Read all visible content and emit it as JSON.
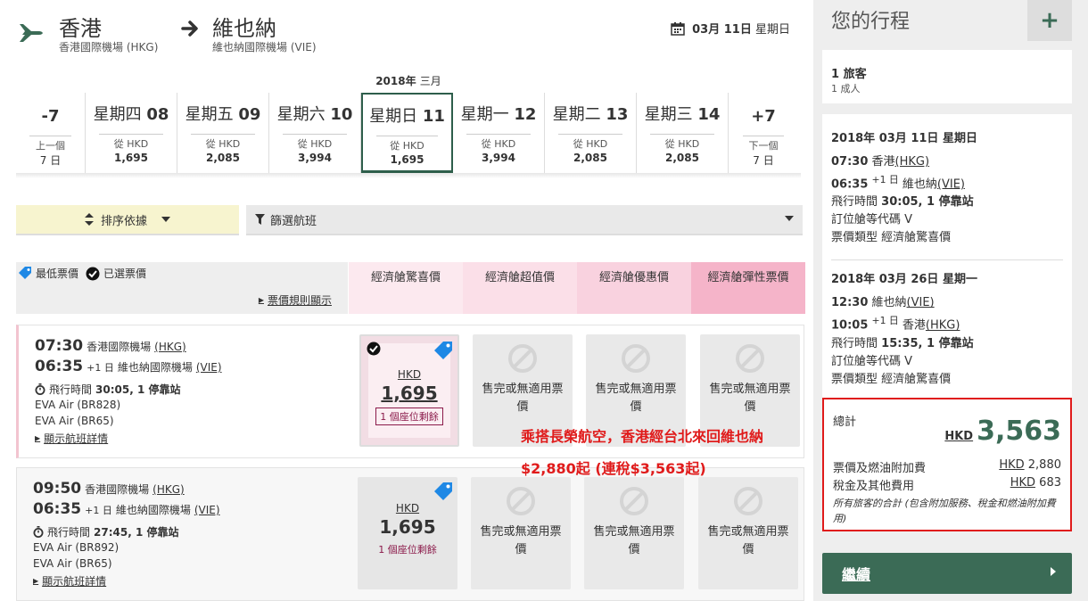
{
  "route": {
    "origin_city": "香港",
    "origin_airport": "香港國際機場 (HKG)",
    "dest_city": "維也納",
    "dest_airport": "維也納國際機場 (VIE)",
    "date_label": "03月 11日 星期日",
    "date_bold": "03月 11日",
    "date_day": "星期日"
  },
  "calendar": {
    "year": "2018年",
    "month": "三月",
    "prev": {
      "big": "-7",
      "label": "上一個",
      "days": "7 日"
    },
    "next": {
      "big": "+7",
      "label": "下一個",
      "days": "7 日"
    },
    "days": [
      {
        "weekday": "星期四",
        "day": "08",
        "from": "從 HKD",
        "price": "1,695"
      },
      {
        "weekday": "星期五",
        "day": "09",
        "from": "從 HKD",
        "price": "2,085"
      },
      {
        "weekday": "星期六",
        "day": "10",
        "from": "從 HKD",
        "price": "3,994"
      },
      {
        "weekday": "星期日",
        "day": "11",
        "from": "從 HKD",
        "price": "1,695"
      },
      {
        "weekday": "星期一",
        "day": "12",
        "from": "從 HKD",
        "price": "3,994"
      },
      {
        "weekday": "星期二",
        "day": "13",
        "from": "從 HKD",
        "price": "2,085"
      },
      {
        "weekday": "星期三",
        "day": "14",
        "from": "從 HKD",
        "price": "2,085"
      }
    ]
  },
  "filters": {
    "sort_label": "排序依據",
    "filter_label": "篩選航班"
  },
  "legend": {
    "lowest": "最低票價",
    "selected": "已選票價",
    "rules_link": "票價規則顯示"
  },
  "fare_columns": [
    "經濟艙驚喜價",
    "經濟艙超值價",
    "經濟艙優惠價",
    "經濟艙彈性票價"
  ],
  "flights": [
    {
      "depart_time": "07:30",
      "depart_airport": "香港國際機場",
      "depart_code": "(HKG)",
      "arrive_time": "06:35",
      "plus_day": "+1 日",
      "arrive_airport": "維也納國際機場",
      "arrive_code": "(VIE)",
      "duration_label": "飛行時間",
      "duration": "30:05, 1 停靠站",
      "legs": [
        "EVA Air (BR828)",
        "EVA Air (BR65)"
      ],
      "details_link": "顯示航班詳情",
      "fare_currency": "HKD",
      "fare_amount": "1,695",
      "seats": "1 個座位剩餘",
      "na_text": "售完或無適用票價"
    },
    {
      "depart_time": "09:50",
      "depart_airport": "香港國際機場",
      "depart_code": "(HKG)",
      "arrive_time": "06:35",
      "plus_day": "+1 日",
      "arrive_airport": "維也納國際機場",
      "arrive_code": "(VIE)",
      "duration_label": "飛行時間",
      "duration": "27:45, 1 停靠站",
      "legs": [
        "EVA Air (BR892)",
        "EVA Air (BR65)"
      ],
      "details_link": "顯示航班詳情",
      "fare_currency": "HKD",
      "fare_amount": "1,695",
      "seats": "1 個座位剩餘",
      "na_text": "售完或無適用票價"
    }
  ],
  "promo": {
    "line1": "乘搭長榮航空，香港經台北來回維也納",
    "line2": "$2,880起 (連稅$3,563起)"
  },
  "itinerary": {
    "title": "您的行程",
    "plus": "+",
    "pax_count": "1 旅客",
    "pax_detail": "1 成人",
    "outbound": {
      "date": "2018年 03月 11日 星期日",
      "dep": "07:30",
      "dep_city": "香港",
      "dep_code": "(HKG)",
      "arr": "06:35",
      "plus": "+1 日",
      "arr_city": "維也納",
      "arr_code": "(VIE)",
      "duration_label": "飛行時間",
      "duration": "30:05, 1 停靠站",
      "booking_class": "訂位艙等代碼 V",
      "fare_type": "票價類型 經濟艙驚喜價"
    },
    "inbound": {
      "date": "2018年 03月 26日 星期一",
      "dep": "12:30",
      "dep_city": "維也納",
      "dep_code": "(VIE)",
      "arr": "10:05",
      "plus": "+1 日",
      "arr_city": "香港",
      "arr_code": "(HKG)",
      "duration_label": "飛行時間",
      "duration": "15:35, 1 停靠站",
      "booking_class": "訂位艙等代碼 V",
      "fare_type": "票價類型 經濟艙驚喜價"
    },
    "total": {
      "label": "總計",
      "currency": "HKD",
      "amount": "3,563",
      "line1_label": "票價及燃油附加費",
      "line1_cur": "HKD",
      "line1_val": "2,880",
      "line2_label": "稅金及其他費用",
      "line2_cur": "HKD",
      "line2_val": "683",
      "note": "所有旅客的合計 (包含附加服務、稅金和燃油附加費用)"
    },
    "continue": "繼續"
  },
  "colors": {
    "brand_green": "#3b6b56",
    "promo_red": "#e01b1b",
    "seat_text": "#8b1a4a"
  }
}
